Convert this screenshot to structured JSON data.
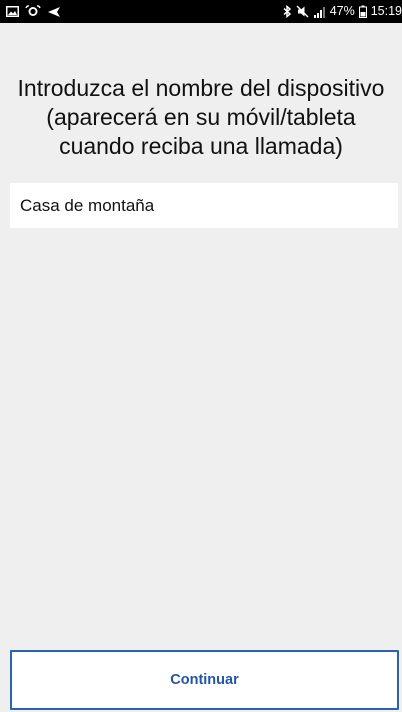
{
  "status_bar": {
    "battery": "47%",
    "time": "15:19",
    "icons": [
      "gallery-icon",
      "alarm-icon",
      "send-icon",
      "bluetooth-icon",
      "mute-icon",
      "signal-icon",
      "battery-icon"
    ]
  },
  "prompt": {
    "line1": "Introduzca el nombre del dispositivo",
    "line2": "(aparecerá en su móvil/tableta",
    "line3": "cuando reciba una llamada)"
  },
  "device_name": {
    "value": "Casa de montaña"
  },
  "continue_button": {
    "label": "Continuar"
  },
  "colors": {
    "background": "#efefef",
    "status_bar": "#000000",
    "accent": "#2962ad"
  }
}
